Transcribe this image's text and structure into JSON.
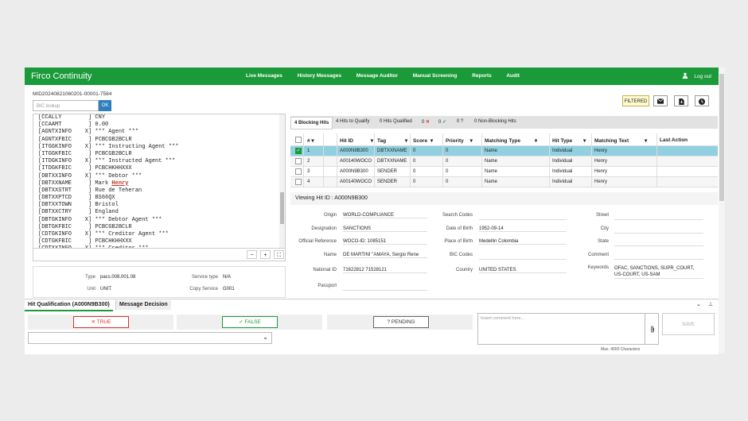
{
  "header": {
    "title": "Firco Continuity",
    "nav": [
      "Live Messages",
      "History Messages",
      "Message Auditor",
      "Manual Screening",
      "Reports",
      "Audit"
    ],
    "logout": "Log out",
    "accent": "#1b9a3a"
  },
  "toolbar": {
    "message_id": "MID20240821060201-00001-7584",
    "bic_placeholder": "BIC lookup",
    "ok": "OK",
    "filtered": "FILTERED"
  },
  "message_lines": [
    "[CCALLY        ] CNY",
    "[CCAAMT        ] 0.00",
    "[AGNTXINFO    X] *** Agent ***",
    "[AGNTXFBIC     ] PCBCGB2BCLR",
    "[ITGGKINFO    X] *** Instructing Agent ***",
    "[ITGGKFBIC     ] PCBCGB2BCLR",
    "[ITDGKINFO    X] *** Instructed Agent ***",
    "[ITDGKFBIC     ] PCBCHKHHXXX",
    "[DBTXXINFO    X] *** Debtor ***",
    "[DBTXXNAME     ] Mark |Henry",
    "[DBTXXSTRT     ] Rue de Teheran",
    "[DBTXXPTCD     ] BS66QX",
    "[DBTXXTOWN     ] Bristol",
    "[DBTXXCTRY     ] England",
    "[DBTGKINFO    X] *** Debtor Agent ***",
    "[DBTGKFBIC     ] PCBCGB2BCLR",
    "[CDTGKINFO    X] *** Creditor Agent ***",
    "[CDTGKFBIC     ] PCBCHKHHXXX",
    "[CDTXXINFO    X] *** Creditor ***"
  ],
  "zoom": {
    "minus": "−",
    "plus": "+",
    "fit": "⛶"
  },
  "message_info": {
    "type_label": "Type",
    "type": "pacs.008.001.08",
    "service_type_label": "Service type",
    "service_type": "N/A",
    "unit_label": "Unit",
    "unit": "UNIT",
    "copy_service_label": "Copy Service",
    "copy_service": "G001"
  },
  "hit_tabs": [
    {
      "label": "4 Blocking Hits"
    },
    {
      "label": "4 Hits to Qualify"
    },
    {
      "label": "0 Hits Qualified"
    },
    {
      "label": "0",
      "icon": "✕",
      "color": "#d9302f"
    },
    {
      "label": "0",
      "icon": "✓",
      "color": "#1b9a3a"
    },
    {
      "label": "0 ?"
    },
    {
      "label": "0 Non-Blocking Hits"
    }
  ],
  "hits_table": {
    "columns": [
      "#",
      "Hit ID",
      "Tag",
      "Score",
      "Priority",
      "Matching Type",
      "Hit Type",
      "Matching Text",
      "Last Action"
    ],
    "rows": [
      [
        "1",
        "A000N9B300",
        "DBTXXNAME",
        "0",
        "0",
        "Name",
        "Individual",
        "Henry",
        ""
      ],
      [
        "2",
        "A00140WOCO",
        "DBTXXNAME",
        "0",
        "0",
        "Name",
        "Individual",
        "Henry",
        ""
      ],
      [
        "3",
        "A000N9B300",
        "SENDER",
        "0",
        "0",
        "Name",
        "Individual",
        "Henry",
        ""
      ],
      [
        "4",
        "A00140WOCO",
        "SENDER",
        "0",
        "0",
        "Name",
        "Individual",
        "Henry",
        ""
      ]
    ],
    "selected_color": "#90d0e0"
  },
  "viewing": {
    "title": "Viewing Hit ID : A000N9B300"
  },
  "hit_details": {
    "origin_label": "Origin",
    "origin": "WORLD-COMPLIANCE",
    "designation_label": "Designation",
    "designation": "SANCTIONS",
    "official_ref_label": "Official Reference",
    "official_ref": "WOCO-ID: 1085151",
    "name_label": "Name",
    "name": "DE MARTINI \"AMAYA, Sergio Rene",
    "national_id_label": "National ID",
    "national_id": "71622812 71528121",
    "passport_label": "Passport",
    "passport": "",
    "search_codes_label": "Search Codes",
    "search_codes": "",
    "dob_label": "Date of Birth",
    "dob": "1952-09-14",
    "pob_label": "Place of Birth",
    "pob": "Medellin Colombia",
    "bic_codes_label": "BIC Codes",
    "bic_codes": "",
    "country_label": "Country",
    "country": "UNITED STATES",
    "street_label": "Street",
    "city_label": "City",
    "state_label": "State",
    "comment_label": "Comment",
    "keywords_label": "Keywords",
    "keywords": "OFAC, SANCTIONS, SUPR_COURT, US-COURT, US-SAM"
  },
  "qualification": {
    "tab1": "Hit Qualification (A000N9B300)",
    "tab2": "Message Decision",
    "true_label": "TRUE",
    "true_icon": "✕",
    "false_label": "FALSE",
    "false_icon": "✓",
    "pending_label": "PENDING",
    "pending_icon": "?",
    "comment_placeholder": "Insert comment here...",
    "save": "SAVE",
    "max_chars": "Max. 4000 Characters"
  }
}
